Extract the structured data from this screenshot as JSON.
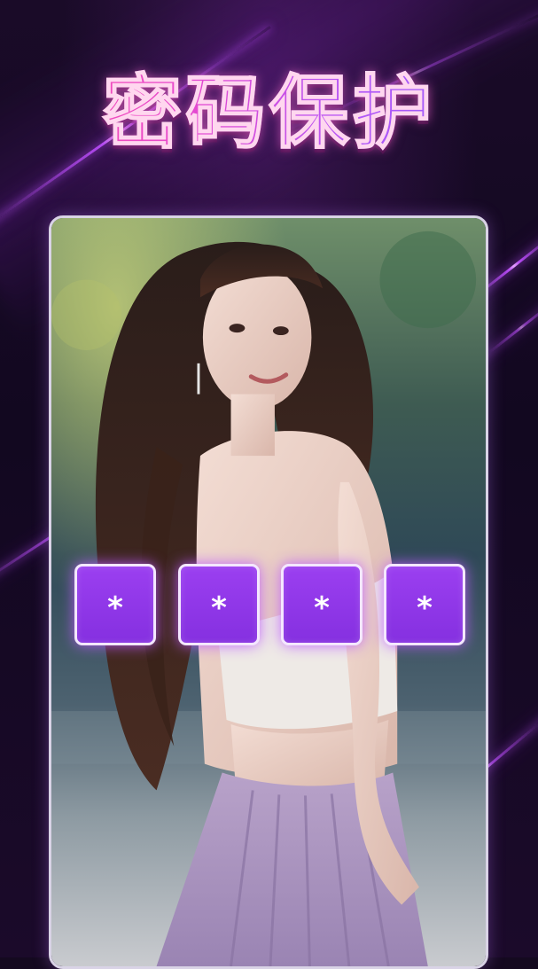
{
  "title": "密码保护",
  "photo": {
    "icon": "portrait-photo"
  },
  "pin": {
    "digits": [
      "*",
      "*",
      "*",
      "*"
    ]
  },
  "colors": {
    "accent": "#8c33e6",
    "title_pink": "#ff4fa8",
    "title_purple": "#8e5cff",
    "background": "#14091f"
  }
}
